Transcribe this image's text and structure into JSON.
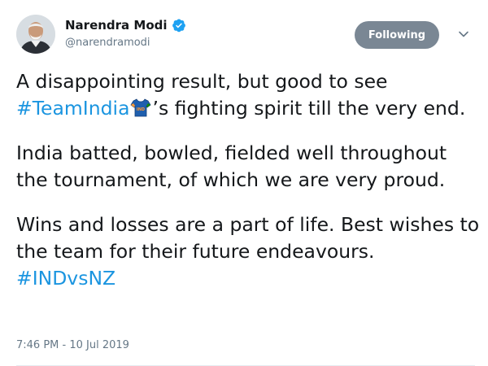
{
  "author": {
    "display_name": "Narendra Modi",
    "handle": "@narendramodi",
    "verified": true,
    "avatar_icon": "profile-photo"
  },
  "follow_button": {
    "label": "Following"
  },
  "tweet": {
    "p1_text": "A disappointing result, but good to see ",
    "p1_hashtag": "#TeamIndia",
    "p1_emoji": "jersey-emoji",
    "p1_rest": "’s fighting spirit till the very end.",
    "p2": "India batted, bowled, fielded well throughout the tournament, of which we are very proud.",
    "p3_text": "Wins and losses are a part of life. Best wishes to the team for their future endeavours.",
    "p3_hashtag": "#INDvsNZ",
    "jersey_text": "IND"
  },
  "timestamp": "7:46 PM - 10 Jul 2019",
  "colors": {
    "link": "#1b95e0",
    "button": "#7a8794",
    "secondary_text": "#657786"
  }
}
